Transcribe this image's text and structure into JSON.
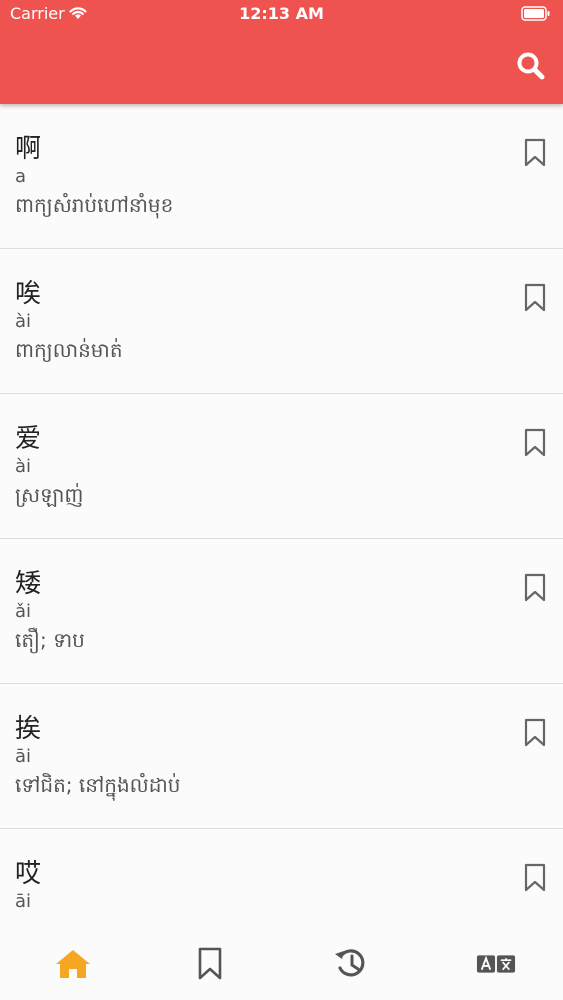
{
  "status_bar": {
    "carrier": "Carrier",
    "time": "12:13 AM"
  },
  "colors": {
    "accent": "#ef5350",
    "tab_active": "#f5a623",
    "tab_inactive": "#555555"
  },
  "header": {
    "search_icon": "search-icon"
  },
  "entries": [
    {
      "word": "啊",
      "pinyin": "a",
      "meaning": "ពាក្យសំរាប់ហៅនាំមុខ"
    },
    {
      "word": "唉",
      "pinyin": "ài",
      "meaning": "ពាក្យលាន់មាត់"
    },
    {
      "word": "爱",
      "pinyin": "ài",
      "meaning": "ស្រឡាញ់"
    },
    {
      "word": "矮",
      "pinyin": "ǎi",
      "meaning": "តឿ; ទាប"
    },
    {
      "word": "挨",
      "pinyin": "āi",
      "meaning": "ទៅជិត; នៅក្នុងលំដាប់"
    },
    {
      "word": "哎",
      "pinyin": "āi",
      "meaning": ""
    }
  ],
  "tabs": [
    {
      "icon": "home-icon",
      "active": true
    },
    {
      "icon": "bookmark-icon",
      "active": false
    },
    {
      "icon": "history-icon",
      "active": false
    },
    {
      "icon": "translate-icon",
      "active": false
    }
  ]
}
